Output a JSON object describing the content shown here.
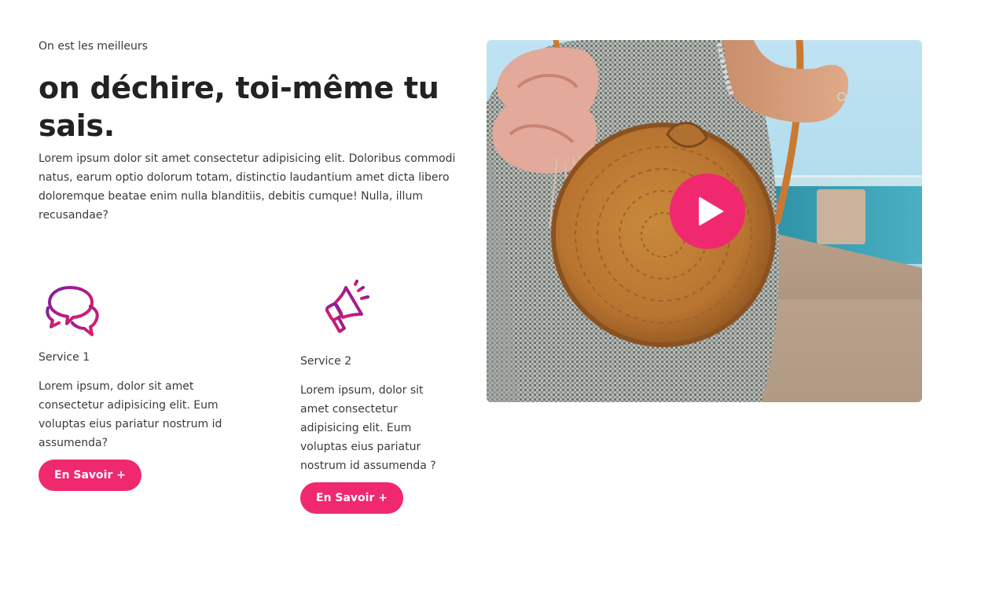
{
  "hero": {
    "eyebrow": "On est les meilleurs",
    "headline": "on déchire, toi-même tu sais.",
    "intro": "Lorem ipsum dolor sit amet consectetur adipisicing elit. Doloribus commodi natus, earum optio dolorum totam, distinctio laudantium amet dicta libero doloremque beatae enim nulla blanditiis, debitis cumque! Nulla, illum recusandae?"
  },
  "services": [
    {
      "icon": "chat-bubbles-icon",
      "title": "Service 1",
      "description": "Lorem ipsum, dolor sit amet consectetur adipisicing elit. Eum voluptas eius pariatur nostrum id assumenda?",
      "button": "En Savoir +"
    },
    {
      "icon": "megaphone-icon",
      "title": "Service 2",
      "description": "Lorem ipsum, dolor sit amet consectetur adipisicing elit. Eum voluptas eius pariatur nostrum id assumenda ?",
      "button": "En Savoir +"
    }
  ],
  "media": {
    "image": "woman-holding-rattan-bag-image",
    "play_icon": "play-icon"
  },
  "colors": {
    "accent": "#f0286e",
    "icon_gradient_start": "#7b1fa2",
    "icon_gradient_end": "#e91e63",
    "text": "#222222"
  }
}
